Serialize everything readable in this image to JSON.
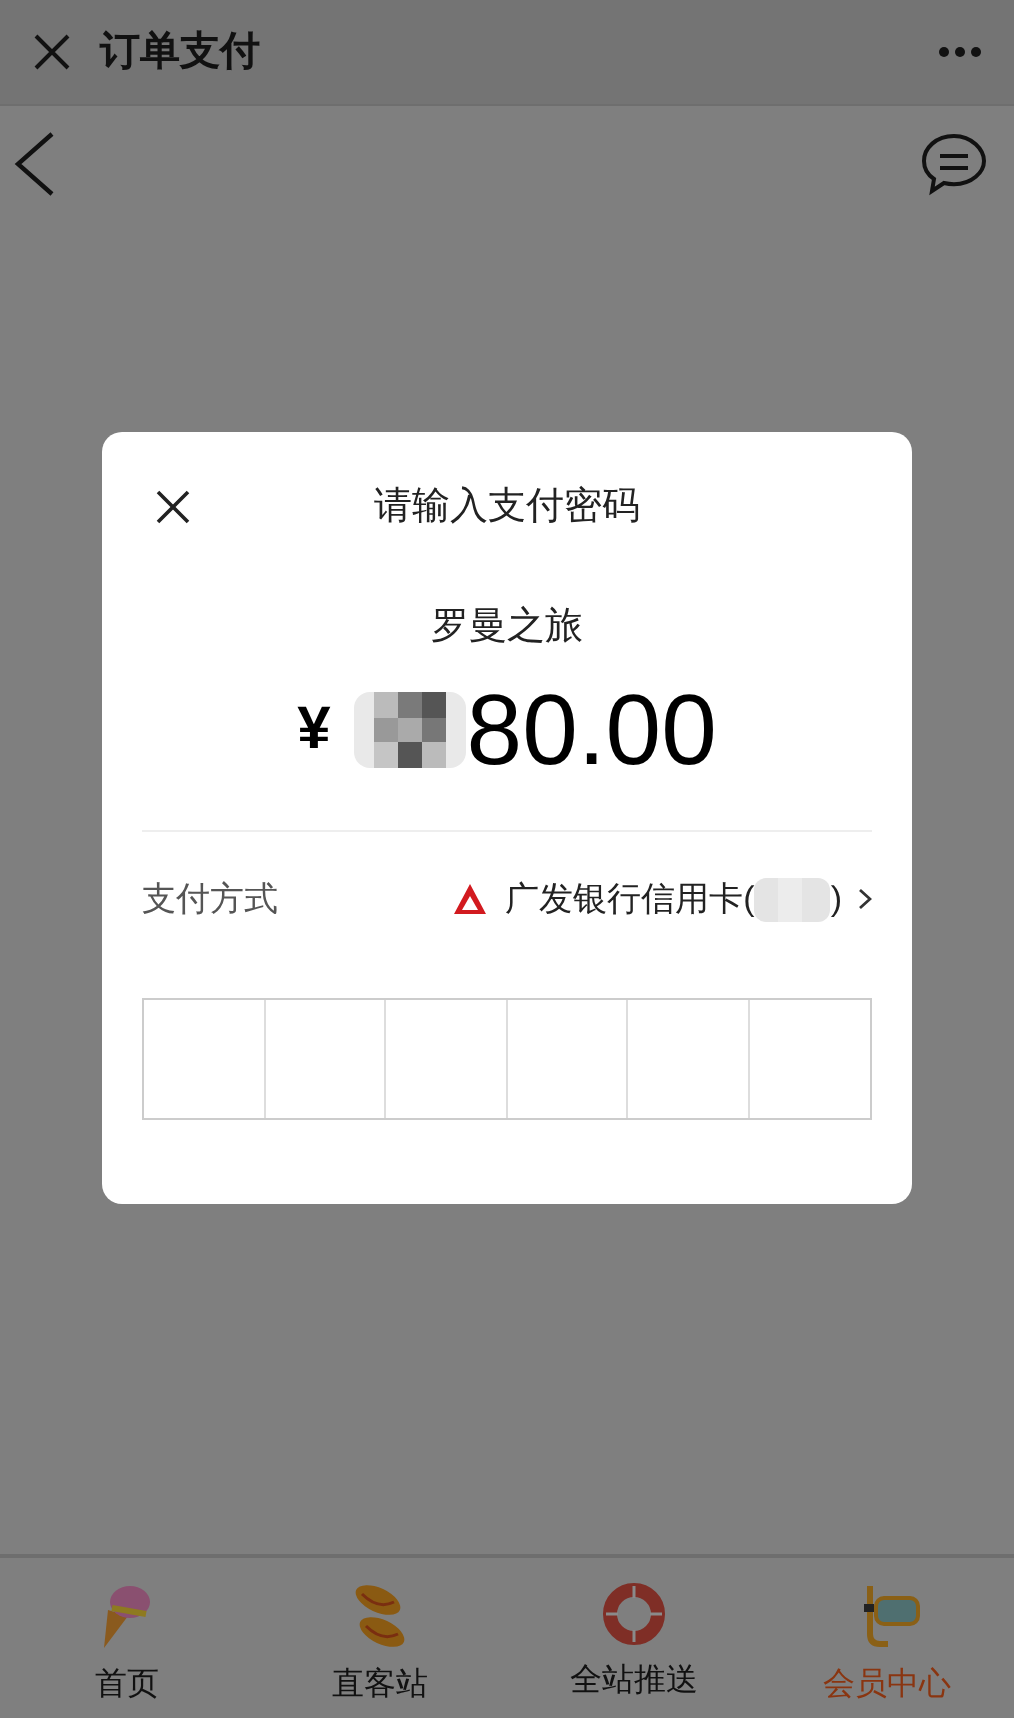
{
  "window": {
    "title": "订单支付"
  },
  "dialog": {
    "title": "请输入支付密码",
    "merchant": "罗曼之旅",
    "currency": "¥",
    "amount_visible": "80.00",
    "payment_label": "支付方式",
    "payment_method": "广发银行信用卡(",
    "payment_method_end": ")",
    "password_cells": [
      {
        "filled": false
      },
      {
        "filled": false
      },
      {
        "filled": false
      },
      {
        "filled": false
      },
      {
        "filled": false
      },
      {
        "filled": false
      }
    ]
  },
  "tab_bar": [
    {
      "label": "首页",
      "kind": "icecream",
      "selected": false
    },
    {
      "label": "直客站",
      "kind": "sandals",
      "selected": false
    },
    {
      "label": "全站推送",
      "kind": "lifebuoy",
      "selected": false
    },
    {
      "label": "会员中心",
      "kind": "goggles",
      "selected": true
    }
  ]
}
